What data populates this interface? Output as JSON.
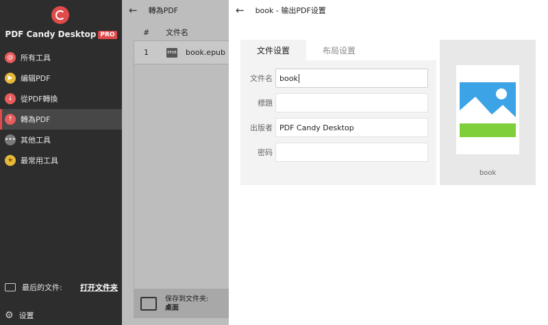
{
  "sidebar": {
    "brand": "PDF Candy Desktop",
    "pro_badge": "PRO",
    "items": [
      {
        "label": "所有工具"
      },
      {
        "label": "编辑PDF"
      },
      {
        "label": "從PDF轉換"
      },
      {
        "label": "轉為PDF"
      },
      {
        "label": "其他工具"
      },
      {
        "label": "最常用工具"
      }
    ],
    "recent_label": "最后的文件:",
    "open_folder": "打开文件夹",
    "settings": "设置"
  },
  "middle": {
    "title": "轉為PDF",
    "col_num": "#",
    "col_name": "文件名",
    "rows": [
      {
        "num": "1",
        "name": "book.epub",
        "badge": "EPUB"
      }
    ],
    "save_to": "保存到文件夹:",
    "folder": "桌面"
  },
  "dialog": {
    "title": "book - 输出PDF设置",
    "tab_file": "文件设置",
    "tab_layout": "布局设置",
    "fields": [
      {
        "label": "文件名",
        "value": "book"
      },
      {
        "label": "標題",
        "value": ""
      },
      {
        "label": "出版者",
        "value": "PDF Candy Desktop"
      },
      {
        "label": "密码",
        "value": ""
      }
    ],
    "preview_label": "book"
  },
  "colors": {
    "accent": "#e04a4a",
    "sidebar_bg": "#2d2d2d",
    "image_sky": "#3ba3e6",
    "image_grass": "#7fcf3a"
  }
}
